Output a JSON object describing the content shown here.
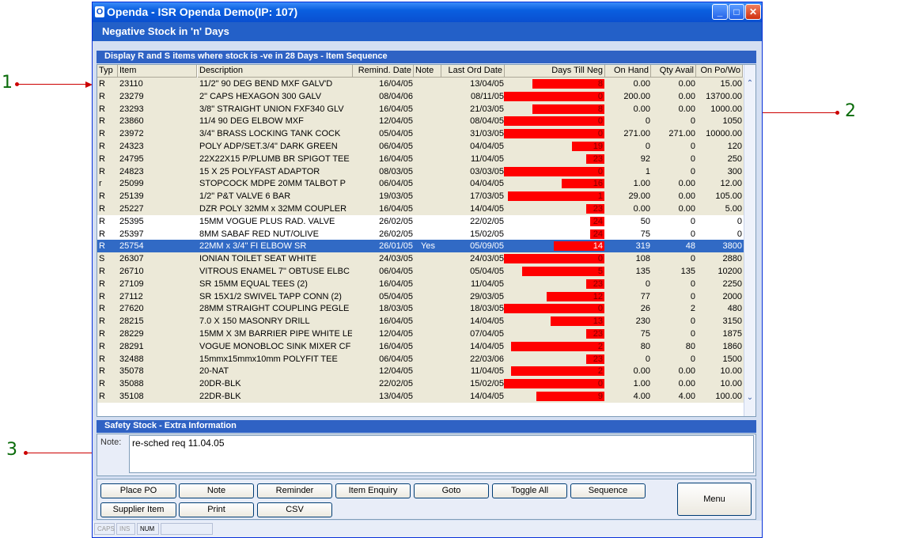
{
  "callouts": [
    "1",
    "2",
    "3"
  ],
  "window": {
    "title": "Openda  -  ISR Openda Demo(IP: 107)",
    "app_icon": "O",
    "controls": [
      "minimize-icon",
      "maximize-icon",
      "close-icon"
    ],
    "subtitle": "Negative Stock in 'n' Days"
  },
  "grid": {
    "header": "Display R and S items where stock is -ve in 28 Days - Item Sequence",
    "columns": [
      "Typ",
      "Item",
      "Description",
      "Remind. Date",
      "Note",
      "Last Ord Date",
      "Days Till Neg",
      "On Hand",
      "Qty Avail",
      "On Po/Wo"
    ],
    "selected_index": 13,
    "rows": [
      {
        "typ": "R",
        "item": "23110",
        "desc": "11/2\" 90 DEG BEND MXF GALV'D",
        "remind": "16/04/05",
        "note": "",
        "last_ord": "13/04/05",
        "days": 8,
        "days_label": "8",
        "on_hand": "0.00",
        "qty_avail": "0.00",
        "on_po": "15.00"
      },
      {
        "typ": "R",
        "item": "23279",
        "desc": "2\" CAPS HEXAGON 300 GALV",
        "remind": "08/04/06",
        "note": "",
        "last_ord": "08/11/05",
        "days": 0,
        "days_label": "0",
        "on_hand": "200.00",
        "qty_avail": "0.00",
        "on_po": "13700.00"
      },
      {
        "typ": "R",
        "item": "23293",
        "desc": "3/8\" STRAIGHT UNION FXF340 GLV",
        "remind": "16/04/05",
        "note": "",
        "last_ord": "21/03/05",
        "days": 8,
        "days_label": "8",
        "on_hand": "0.00",
        "qty_avail": "0.00",
        "on_po": "1000.00"
      },
      {
        "typ": "R",
        "item": "23860",
        "desc": "11/4 90 DEG ELBOW MXF",
        "remind": "12/04/05",
        "note": "",
        "last_ord": "08/04/05",
        "days": 0,
        "days_label": "0",
        "on_hand": "0",
        "qty_avail": "0",
        "on_po": "1050"
      },
      {
        "typ": "R",
        "item": "23972",
        "desc": "3/4\" BRASS LOCKING TANK COCK",
        "remind": "05/04/05",
        "note": "",
        "last_ord": "31/03/05",
        "days": 0,
        "days_label": "0",
        "on_hand": "271.00",
        "qty_avail": "271.00",
        "on_po": "10000.00"
      },
      {
        "typ": "R",
        "item": "24323",
        "desc": "POLY ADP/SET.3/4\" DARK GREEN",
        "remind": "06/04/05",
        "note": "",
        "last_ord": "04/04/05",
        "days": 19,
        "days_label": "19",
        "on_hand": "0",
        "qty_avail": "0",
        "on_po": "120"
      },
      {
        "typ": "R",
        "item": "24795",
        "desc": "22X22X15 P/PLUMB BR SPIGOT TEE",
        "remind": "16/04/05",
        "note": "",
        "last_ord": "11/04/05",
        "days": 23,
        "days_label": "23",
        "on_hand": "92",
        "qty_avail": "0",
        "on_po": "250"
      },
      {
        "typ": "R",
        "item": "24823",
        "desc": "15 X 25 POLYFAST ADAPTOR",
        "remind": "08/03/05",
        "note": "",
        "last_ord": "03/03/05",
        "days": 0,
        "days_label": "0",
        "on_hand": "1",
        "qty_avail": "0",
        "on_po": "300"
      },
      {
        "typ": "r",
        "item": "25099",
        "desc": "STOPCOCK MDPE 20MM TALBOT P",
        "remind": "06/04/05",
        "note": "",
        "last_ord": "04/04/05",
        "days": 16,
        "days_label": "16",
        "on_hand": "1.00",
        "qty_avail": "0.00",
        "on_po": "12.00"
      },
      {
        "typ": "R",
        "item": "25139",
        "desc": "1/2\" P&T VALVE 6 BAR",
        "remind": "19/03/05",
        "note": "",
        "last_ord": "17/03/05",
        "days": 1,
        "days_label": "1",
        "on_hand": "29.00",
        "qty_avail": "0.00",
        "on_po": "105.00"
      },
      {
        "typ": "R",
        "item": "25227",
        "desc": "DZR POLY 32MM x 32MM COUPLER",
        "remind": "16/04/05",
        "note": "",
        "last_ord": "14/04/05",
        "days": 23,
        "days_label": "23",
        "on_hand": "0.00",
        "qty_avail": "0.00",
        "on_po": "5.00"
      },
      {
        "typ": "R",
        "item": "25395",
        "desc": "15MM VOGUE PLUS RAD. VALVE",
        "remind": "26/02/05",
        "note": "",
        "last_ord": "22/02/05",
        "days": 24,
        "days_label": "24",
        "on_hand": "50",
        "qty_avail": "0",
        "on_po": "0"
      },
      {
        "typ": "R",
        "item": "25397",
        "desc": "8MM SABAF RED NUT/OLIVE",
        "remind": "26/02/05",
        "note": "",
        "last_ord": "15/02/05",
        "days": 24,
        "days_label": "24",
        "on_hand": "75",
        "qty_avail": "0",
        "on_po": "0"
      },
      {
        "typ": "R",
        "item": "25754",
        "desc": "22MM x 3/4\" FI ELBOW         SR",
        "remind": "26/01/05",
        "note": "Yes",
        "last_ord": "05/09/05",
        "days": 14,
        "days_label": "14",
        "on_hand": "319",
        "qty_avail": "48",
        "on_po": "3800"
      },
      {
        "typ": "S",
        "item": "26307",
        "desc": "IONIAN TOILET SEAT WHITE",
        "remind": "24/03/05",
        "note": "",
        "last_ord": "24/03/05",
        "days": 0,
        "days_label": "0",
        "on_hand": "108",
        "qty_avail": "0",
        "on_po": "2880"
      },
      {
        "typ": "R",
        "item": "26710",
        "desc": "VITROUS ENAMEL 7\" OBTUSE ELBC",
        "remind": "06/04/05",
        "note": "",
        "last_ord": "05/04/05",
        "days": 5,
        "days_label": "5",
        "on_hand": "135",
        "qty_avail": "135",
        "on_po": "10200"
      },
      {
        "typ": "R",
        "item": "27109",
        "desc": "SR 15MM EQUAL TEES (2)",
        "remind": "16/04/05",
        "note": "",
        "last_ord": "11/04/05",
        "days": 23,
        "days_label": "23",
        "on_hand": "0",
        "qty_avail": "0",
        "on_po": "2250"
      },
      {
        "typ": "R",
        "item": "27112",
        "desc": "SR 15X1/2 SWIVEL TAPP CONN (2)",
        "remind": "05/04/05",
        "note": "",
        "last_ord": "29/03/05",
        "days": 12,
        "days_label": "12",
        "on_hand": "77",
        "qty_avail": "0",
        "on_po": "2000"
      },
      {
        "typ": "R",
        "item": "27620",
        "desc": "28MM STRAIGHT COUPLING PEGLE",
        "remind": "18/03/05",
        "note": "",
        "last_ord": "18/03/05",
        "days": 0,
        "days_label": "0",
        "on_hand": "26",
        "qty_avail": "2",
        "on_po": "480"
      },
      {
        "typ": "R",
        "item": "28215",
        "desc": "7.0 X 150 MASONRY DRILL",
        "remind": "16/04/05",
        "note": "",
        "last_ord": "14/04/05",
        "days": 13,
        "days_label": "13",
        "on_hand": "230",
        "qty_avail": "0",
        "on_po": "3150"
      },
      {
        "typ": "R",
        "item": "28229",
        "desc": "15MM X 3M BARRIER PIPE WHITE LE",
        "remind": "12/04/05",
        "note": "",
        "last_ord": "07/04/05",
        "days": 23,
        "days_label": "23",
        "on_hand": "75",
        "qty_avail": "0",
        "on_po": "1875"
      },
      {
        "typ": "R",
        "item": "28291",
        "desc": "VOGUE MONOBLOC SINK MIXER CF",
        "remind": "16/04/05",
        "note": "",
        "last_ord": "14/04/05",
        "days": 2,
        "days_label": "2",
        "on_hand": "80",
        "qty_avail": "80",
        "on_po": "1860"
      },
      {
        "typ": "R",
        "item": "32488",
        "desc": "15mmx15mmx10mm POLYFIT TEE",
        "remind": "06/04/05",
        "note": "",
        "last_ord": "22/03/06",
        "days": 23,
        "days_label": "23",
        "on_hand": "0",
        "qty_avail": "0",
        "on_po": "1500"
      },
      {
        "typ": "R",
        "item": "35078",
        "desc": "20-NAT",
        "remind": "12/04/05",
        "note": "",
        "last_ord": "11/04/05",
        "days": 2,
        "days_label": "2",
        "on_hand": "0.00",
        "qty_avail": "0.00",
        "on_po": "10.00"
      },
      {
        "typ": "R",
        "item": "35088",
        "desc": "20DR-BLK",
        "remind": "22/02/05",
        "note": "",
        "last_ord": "15/02/05",
        "days": 0,
        "days_label": "0",
        "on_hand": "1.00",
        "qty_avail": "0.00",
        "on_po": "10.00"
      },
      {
        "typ": "R",
        "item": "35108",
        "desc": "22DR-BLK",
        "remind": "13/04/05",
        "note": "",
        "last_ord": "14/04/05",
        "days": 9,
        "days_label": "9",
        "on_hand": "4.00",
        "qty_avail": "4.00",
        "on_po": "100.00"
      }
    ]
  },
  "extra": {
    "header": "Safety Stock - Extra Information",
    "note_label": "Note:",
    "note_value": "re-sched req 11.04.05"
  },
  "buttons": {
    "row1": [
      "Place PO",
      "Note",
      "Reminder",
      "Item Enquiry",
      "Goto",
      "Toggle All",
      "Sequence"
    ],
    "row2": [
      "Supplier Item",
      "Print",
      "CSV"
    ],
    "menu": "Menu"
  },
  "status": [
    "CAPS",
    "INS",
    "NUM"
  ],
  "colors": {
    "bar": "#ff0000",
    "row_tan": "#ece9d8",
    "row_white": "#ffffff",
    "selected": "#316ac5",
    "callout": "#0a6b0a",
    "arrow": "#cc0000"
  }
}
